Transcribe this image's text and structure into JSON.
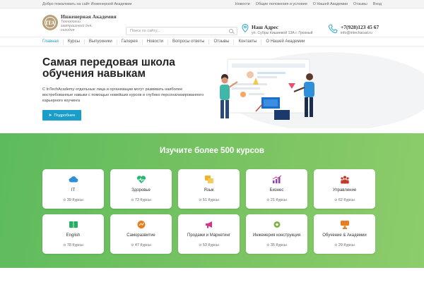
{
  "topbar": {
    "welcome": "Добро пожаловать на сайт Инженерной Академии",
    "links": [
      "Новости",
      "Общие положения и условия",
      "О Нашей Академии",
      "Отзывы",
      "Вход"
    ]
  },
  "logo": {
    "mark": "ITA",
    "title": "Инженерная Академия",
    "tagline": "Технологии завтрашнего дня, сегодня"
  },
  "search": {
    "placeholder": "Поиск по сайту..."
  },
  "address": {
    "title": "Наш Адрес",
    "value": "ул. Субры Кишиевой 13А г. Грозный"
  },
  "phone": {
    "number": "+7(928)123 45 67",
    "email": "info@intechacad.ru"
  },
  "nav": [
    "Главная",
    "Курсы",
    "Выпускники",
    "Галерея",
    "Новости",
    "Вопросы ответы",
    "Отзывы",
    "Контакты",
    "О Нашей Академии"
  ],
  "hero": {
    "title": "Самая передовая школа обучения навыкам",
    "description": "С InTechAcademy отдельные лица и организации могут развивать наиболее востребованные навыки с помощью новейших курсов и глубоко персонализированного карьерного коучинга",
    "button": "Подробнее"
  },
  "courses": {
    "heading": "Изучите более 500 курсов",
    "items": [
      {
        "title": "IT",
        "count": "39 Курсы",
        "icon": "cloud-icon",
        "color": "#2f8fd8"
      },
      {
        "title": "Здоровье",
        "count": "73 Курсы",
        "icon": "heart-pulse-icon",
        "color": "#2bb673"
      },
      {
        "title": "Язык",
        "count": "51 Курсы",
        "icon": "translate-icon",
        "color": "#f0b429"
      },
      {
        "title": "Бизнес",
        "count": "21 Курсы",
        "icon": "chart-icon",
        "color": "#8e44ad"
      },
      {
        "title": "Управление",
        "count": "62 Курсы",
        "icon": "team-icon",
        "color": "#c0392b"
      },
      {
        "title": "English",
        "count": "78 Курсы",
        "icon": "book-icon",
        "color": "#27ae60"
      },
      {
        "title": "Саморазвитие",
        "count": "47 Курсы",
        "icon": "growth-icon",
        "color": "#e67e22"
      },
      {
        "title": "Продажи и Маркетинг",
        "count": "53 Курсы",
        "icon": "megaphone-icon",
        "color": "#d63384"
      },
      {
        "title": "Инженерия конструкция",
        "count": "35 Курсы",
        "icon": "gear-icon",
        "color": "#7cb342"
      },
      {
        "title": "Обучение & Академии",
        "count": "29 Курсы",
        "icon": "presentation-icon",
        "color": "#e67e22"
      }
    ]
  }
}
